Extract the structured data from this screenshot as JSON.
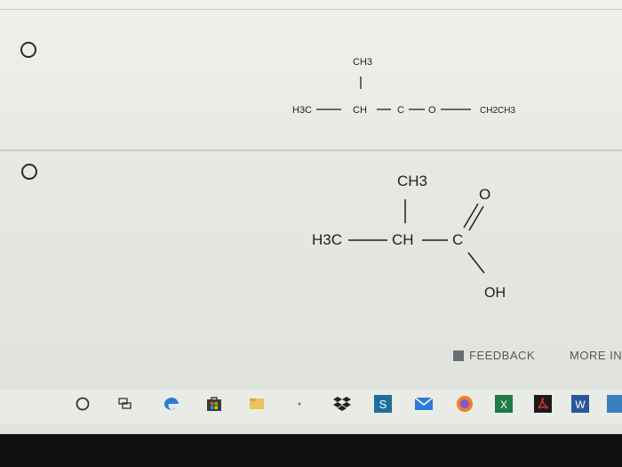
{
  "question": {
    "options": [
      {
        "structure": {
          "top": "CH3",
          "left": "H3C",
          "center": "CH",
          "carbon": "C",
          "oxygen": "O",
          "right": "CH2CH3"
        }
      },
      {
        "structure": {
          "top": "CH3",
          "left": "H3C",
          "center": "CH",
          "carbon": "C",
          "carbonyl_oxygen": "O",
          "hydroxyl": "OH"
        }
      }
    ]
  },
  "footer": {
    "feedback_label": "FEEDBACK",
    "more_info_label": "MORE IN"
  },
  "taskbar": {
    "icons": [
      "search-icon",
      "task-view-icon",
      "edge-icon",
      "store-icon",
      "files-icon",
      "dropbox-icon",
      "app-icon",
      "mail-icon",
      "firefox-icon",
      "excel-icon",
      "acrobat-icon",
      "word-icon"
    ],
    "excel_letter": "X",
    "word_letter": "W",
    "app_letter": "S"
  },
  "colors": {
    "accent_blue": "#2f7ad6",
    "excel_green": "#1f7a45",
    "word_blue": "#2b579a"
  }
}
